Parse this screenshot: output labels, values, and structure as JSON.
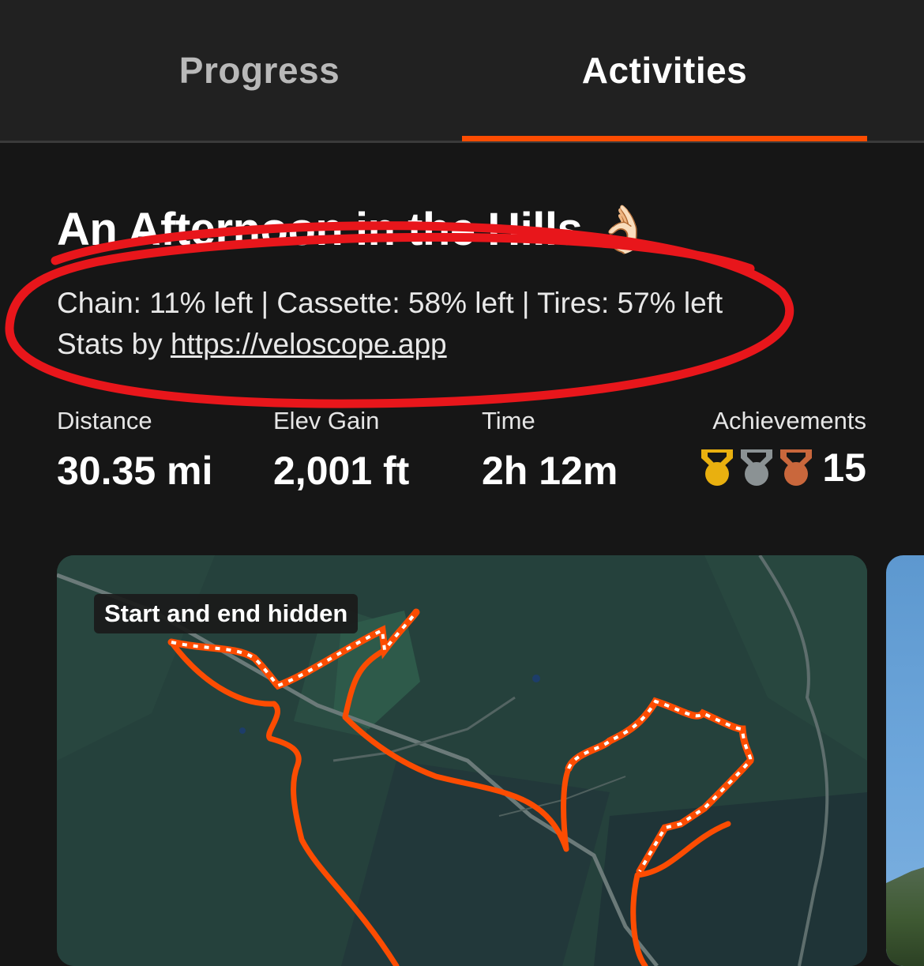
{
  "tabs": [
    {
      "label": "Progress",
      "active": false
    },
    {
      "label": "Activities",
      "active": true
    }
  ],
  "colors": {
    "accent": "#fc4c02",
    "annotation": "#e8161b",
    "gold": "#e9b00f",
    "silver": "#8b9294",
    "bronze": "#c9673c"
  },
  "activity": {
    "title": "An Afternoon in the Hills",
    "title_emoji": "👌🏻",
    "description_line1": "Chain: 11% left | Cassette: 58% left | Tires: 57% left",
    "stats_by_prefix": "Stats by ",
    "stats_link": "https://veloscope.app"
  },
  "stats": {
    "distance": {
      "label": "Distance",
      "value": "30.35 mi"
    },
    "elev_gain": {
      "label": "Elev Gain",
      "value": "2,001 ft"
    },
    "time": {
      "label": "Time",
      "value": "2h 12m"
    },
    "achievements": {
      "label": "Achievements",
      "value": "15",
      "medals": [
        "gold-medal-icon",
        "silver-medal-icon",
        "bronze-medal-icon"
      ]
    }
  },
  "map": {
    "badge": "Start and end hidden"
  }
}
